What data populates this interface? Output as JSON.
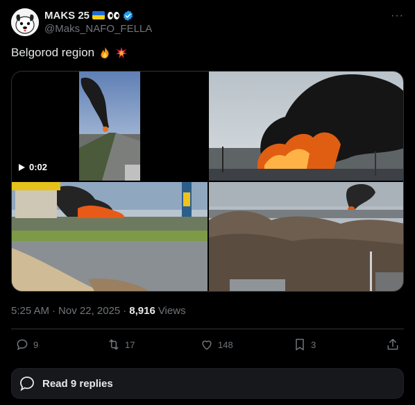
{
  "author": {
    "name": "MAKS 25",
    "handle": "@Maks_NAFO_FELLA"
  },
  "tweet": {
    "text": "Belgorod region",
    "emojis": [
      "fire-emoji",
      "collision-emoji"
    ]
  },
  "media": {
    "video_duration": "0:02",
    "images": [
      "video-highway-smoke",
      "fire-smoke-industrial",
      "gas-station-fire",
      "distant-smoke-trees"
    ]
  },
  "meta": {
    "time": "5:25 AM",
    "separator": "·",
    "date": "Nov 22, 2025",
    "views_count": "8,916",
    "views_label": "Views"
  },
  "actions": {
    "replies": "9",
    "reposts": "17",
    "likes": "148",
    "bookmarks": "3"
  },
  "read_replies": {
    "label": "Read 9 replies"
  },
  "colors": {
    "background": "#000000",
    "text": "#e7e9ea",
    "muted": "#71767b",
    "border": "#2f3336",
    "verified": "#1d9bf0"
  }
}
